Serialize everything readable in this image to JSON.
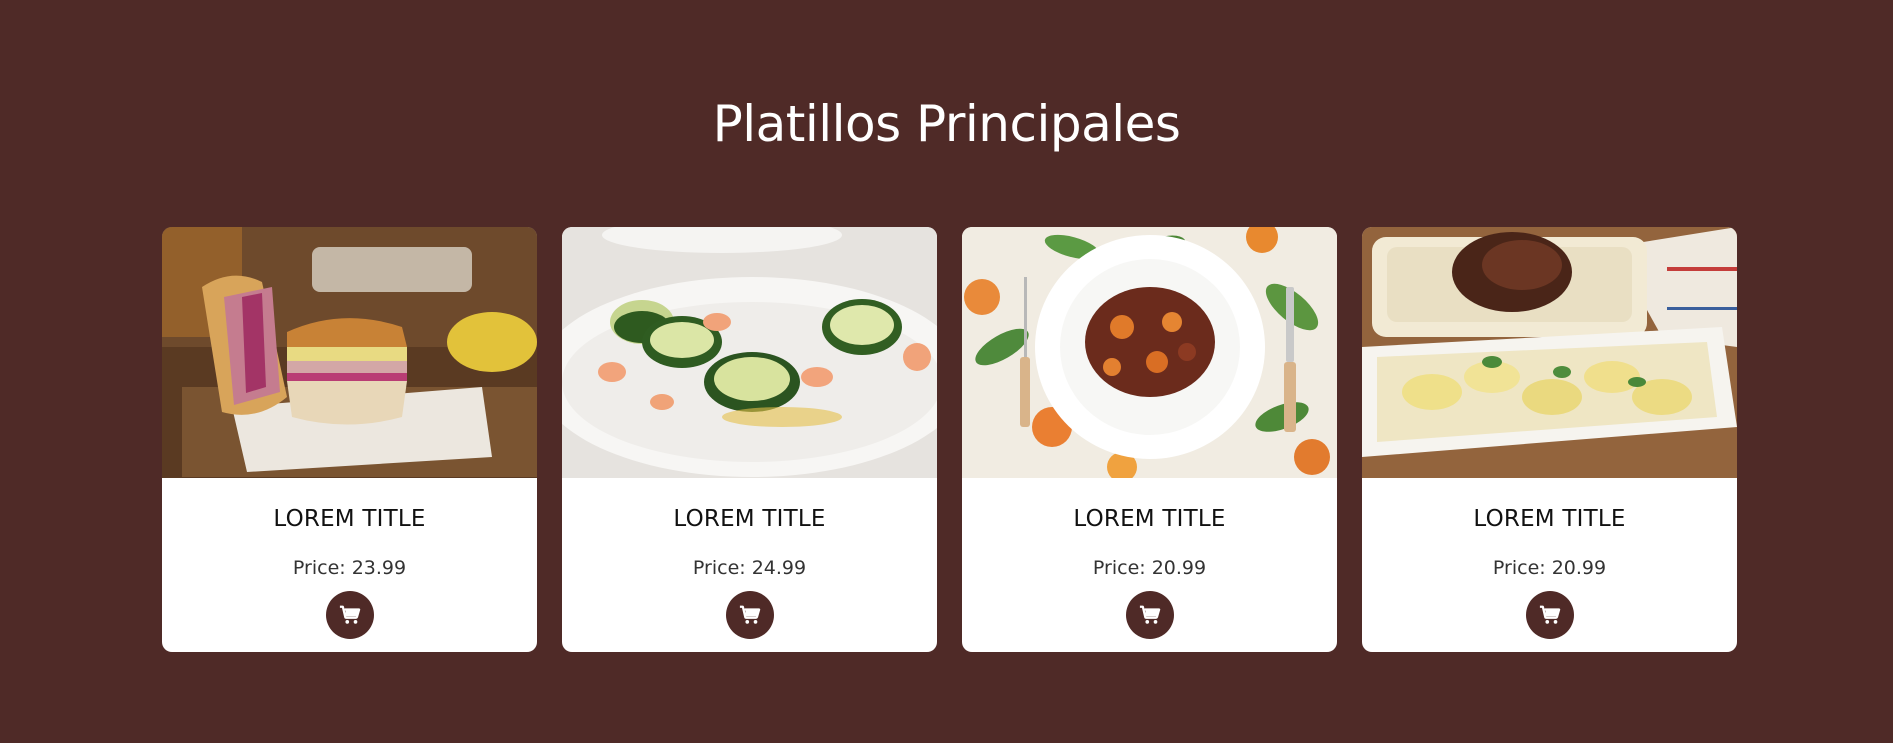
{
  "section": {
    "title": "Platillos Principales"
  },
  "colors": {
    "background": "#4f2a27",
    "card": "#ffffff",
    "button": "#4f2a27"
  },
  "cards": [
    {
      "title": "LOREM TITLE",
      "price": "Price: 23.99",
      "image_icon": "cuban-sandwich-photo",
      "button_icon": "cart-icon"
    },
    {
      "title": "LOREM TITLE",
      "price": "Price: 24.99",
      "image_icon": "zucchini-shrimp-rolls-photo",
      "button_icon": "cart-icon"
    },
    {
      "title": "LOREM TITLE",
      "price": "Price: 20.99",
      "image_icon": "beef-stew-photo",
      "button_icon": "cart-icon"
    },
    {
      "title": "LOREM TITLE",
      "price": "Price: 20.99",
      "image_icon": "roast-chicken-potatoes-photo",
      "button_icon": "cart-icon"
    }
  ]
}
